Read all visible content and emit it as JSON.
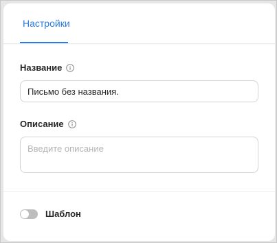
{
  "tabs": [
    {
      "label": "Настройки",
      "active": true
    }
  ],
  "fields": {
    "name": {
      "label": "Название",
      "value": "Письмо без названия.",
      "icon": "info-icon"
    },
    "description": {
      "label": "Описание",
      "value": "",
      "placeholder": "Введите описание",
      "icon": "info-icon"
    }
  },
  "template_toggle": {
    "label": "Шаблон",
    "enabled": false
  },
  "colors": {
    "accent": "#2a7be4",
    "toggle_off": "#bdbdbd",
    "text": "#262626",
    "placeholder": "#b5b5b5"
  }
}
